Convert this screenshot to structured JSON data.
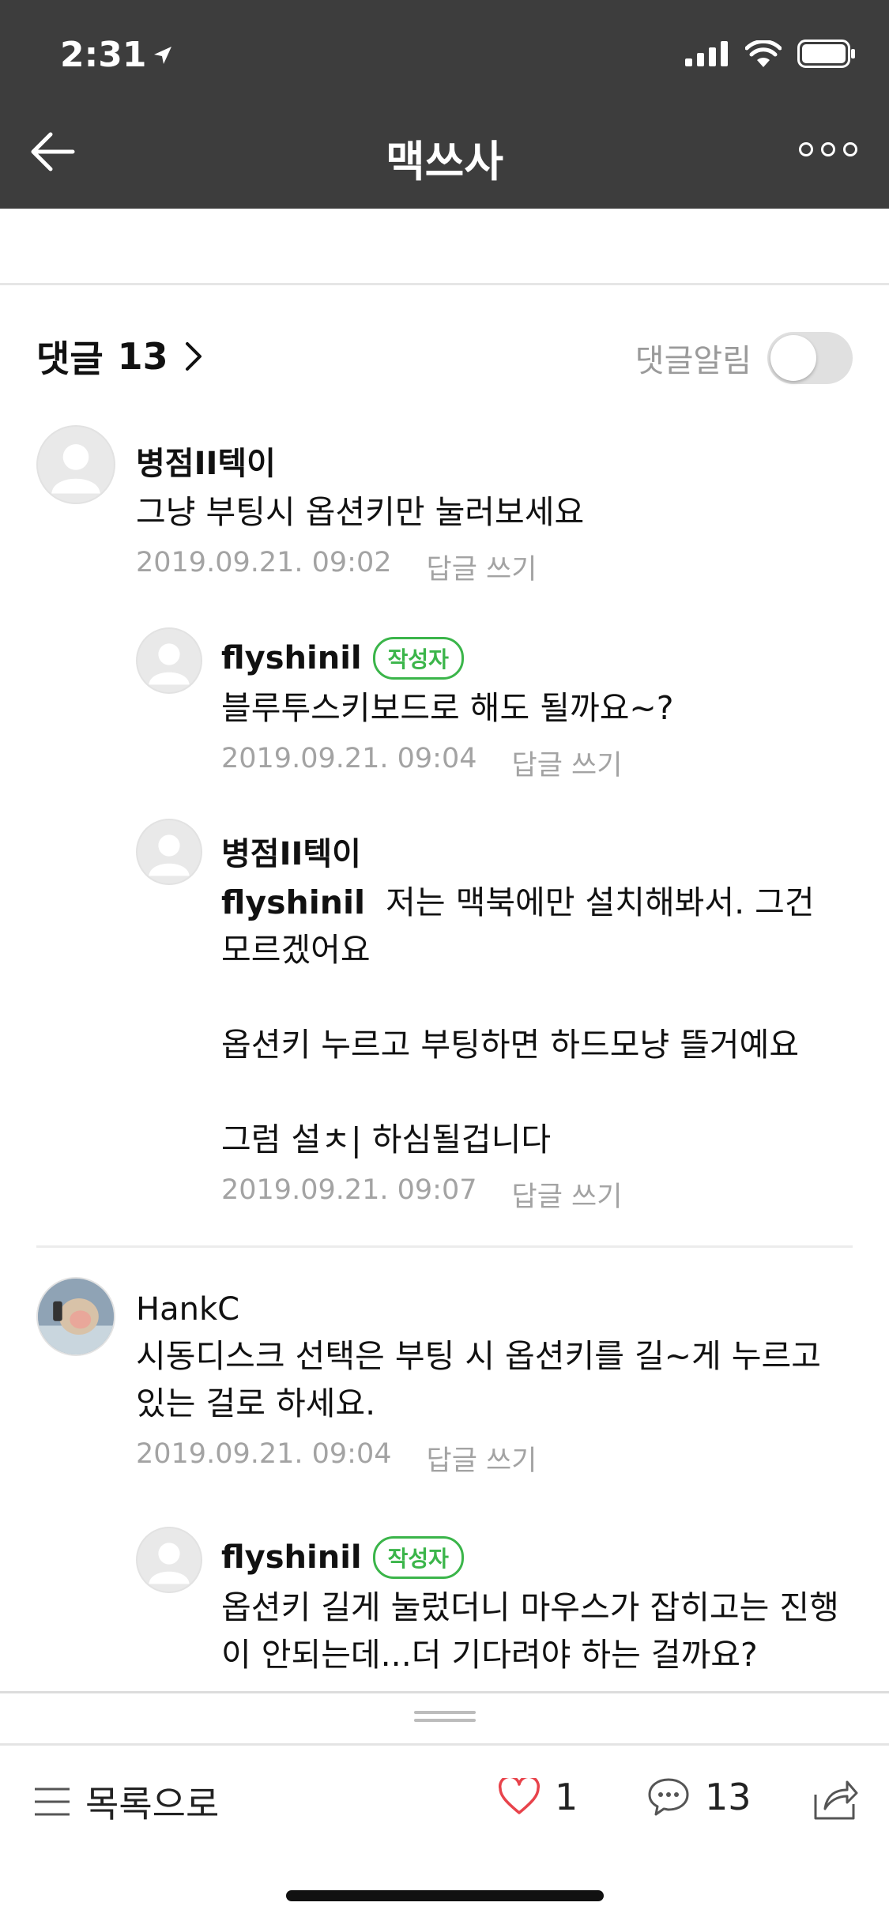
{
  "status": {
    "time": "2:31"
  },
  "nav": {
    "title": "맥쓰사"
  },
  "comments_header": {
    "label": "댓글",
    "count": "13",
    "notify_label": "댓글알림"
  },
  "comments": [
    {
      "author": "병점II텍이",
      "text": "그냥 부팅시 옵션키만 눌러보세요",
      "date": "2019.09.21. 09:02",
      "reply": "답글 쓰기"
    },
    {
      "author": "flyshinil",
      "badge": "작성자",
      "text": "블루투스키보드로 해도 될까요~?",
      "date": "2019.09.21. 09:04",
      "reply": "답글 쓰기"
    },
    {
      "author": "병점II텍이",
      "mention": "flyshinil",
      "text": "  저는 맥북에만 설치해봐서. 그건 모르겠어요\n\n옵션키 누르고 부팅하면 하드모냥 뜰거예요\n\n그럼 설ㅊ| 하심될겁니다",
      "date": "2019.09.21. 09:07",
      "reply": "답글 쓰기"
    },
    {
      "author": "HankC",
      "text": "시동디스크 선택은 부팅 시 옵션키를 길~게 누르고 있는 걸로 하세요.",
      "date": "2019.09.21. 09:04",
      "reply": "답글 쓰기"
    },
    {
      "author": "flyshinil",
      "badge": "작성자",
      "text": "옵션키 길게 눌렀더니 마우스가 잡히고는 진행이 안되는데...더 기다려야 하는 걸까요?"
    }
  ],
  "bottom": {
    "list_label": "목록으로",
    "likes": "1",
    "comment_count": "13"
  },
  "colors": {
    "header_bg": "#3d3d3d",
    "badge_green": "#3bb54a",
    "like_red": "#e8434b"
  }
}
